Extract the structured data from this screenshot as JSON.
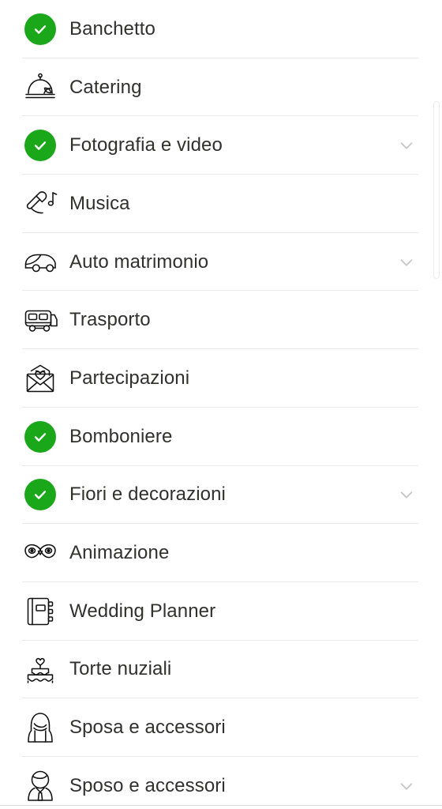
{
  "page": {
    "title": "Categorie servizi matrimonio",
    "colors": {
      "badge_green": "#1aa81a",
      "divider": "#e9e9e9",
      "label_text": "#30302f",
      "chevron": "#c6c6c6",
      "background": "#ffffff"
    }
  },
  "scrollbar": {
    "name": "vertical-scrollbar",
    "orientation": "vertical"
  },
  "list": {
    "items": [
      {
        "label": "Banchetto",
        "icon": "check-circle-icon",
        "completed": true,
        "chevron": false
      },
      {
        "label": "Catering",
        "icon": "cloche-icon",
        "completed": false,
        "chevron": false
      },
      {
        "label": "Fotografia e video",
        "icon": "check-circle-icon",
        "completed": true,
        "chevron": true
      },
      {
        "label": "Musica",
        "icon": "microphone-note-icon",
        "completed": false,
        "chevron": false
      },
      {
        "label": "Auto matrimonio",
        "icon": "car-icon",
        "completed": false,
        "chevron": true
      },
      {
        "label": "Trasporto",
        "icon": "bus-icon",
        "completed": false,
        "chevron": false
      },
      {
        "label": "Partecipazioni",
        "icon": "envelope-heart-icon",
        "completed": false,
        "chevron": false
      },
      {
        "label": "Bomboniere",
        "icon": "check-circle-icon",
        "completed": true,
        "chevron": false
      },
      {
        "label": "Fiori e decorazioni",
        "icon": "check-circle-icon",
        "completed": true,
        "chevron": true
      },
      {
        "label": "Animazione",
        "icon": "carnival-mask-icon",
        "completed": false,
        "chevron": false
      },
      {
        "label": "Wedding Planner",
        "icon": "notebook-icon",
        "completed": false,
        "chevron": false
      },
      {
        "label": "Torte nuziali",
        "icon": "wedding-cake-icon",
        "completed": false,
        "chevron": false
      },
      {
        "label": "Sposa e accessori",
        "icon": "bride-icon",
        "completed": false,
        "chevron": false
      },
      {
        "label": "Sposo e accessori",
        "icon": "groom-icon",
        "completed": false,
        "chevron": true
      }
    ]
  }
}
